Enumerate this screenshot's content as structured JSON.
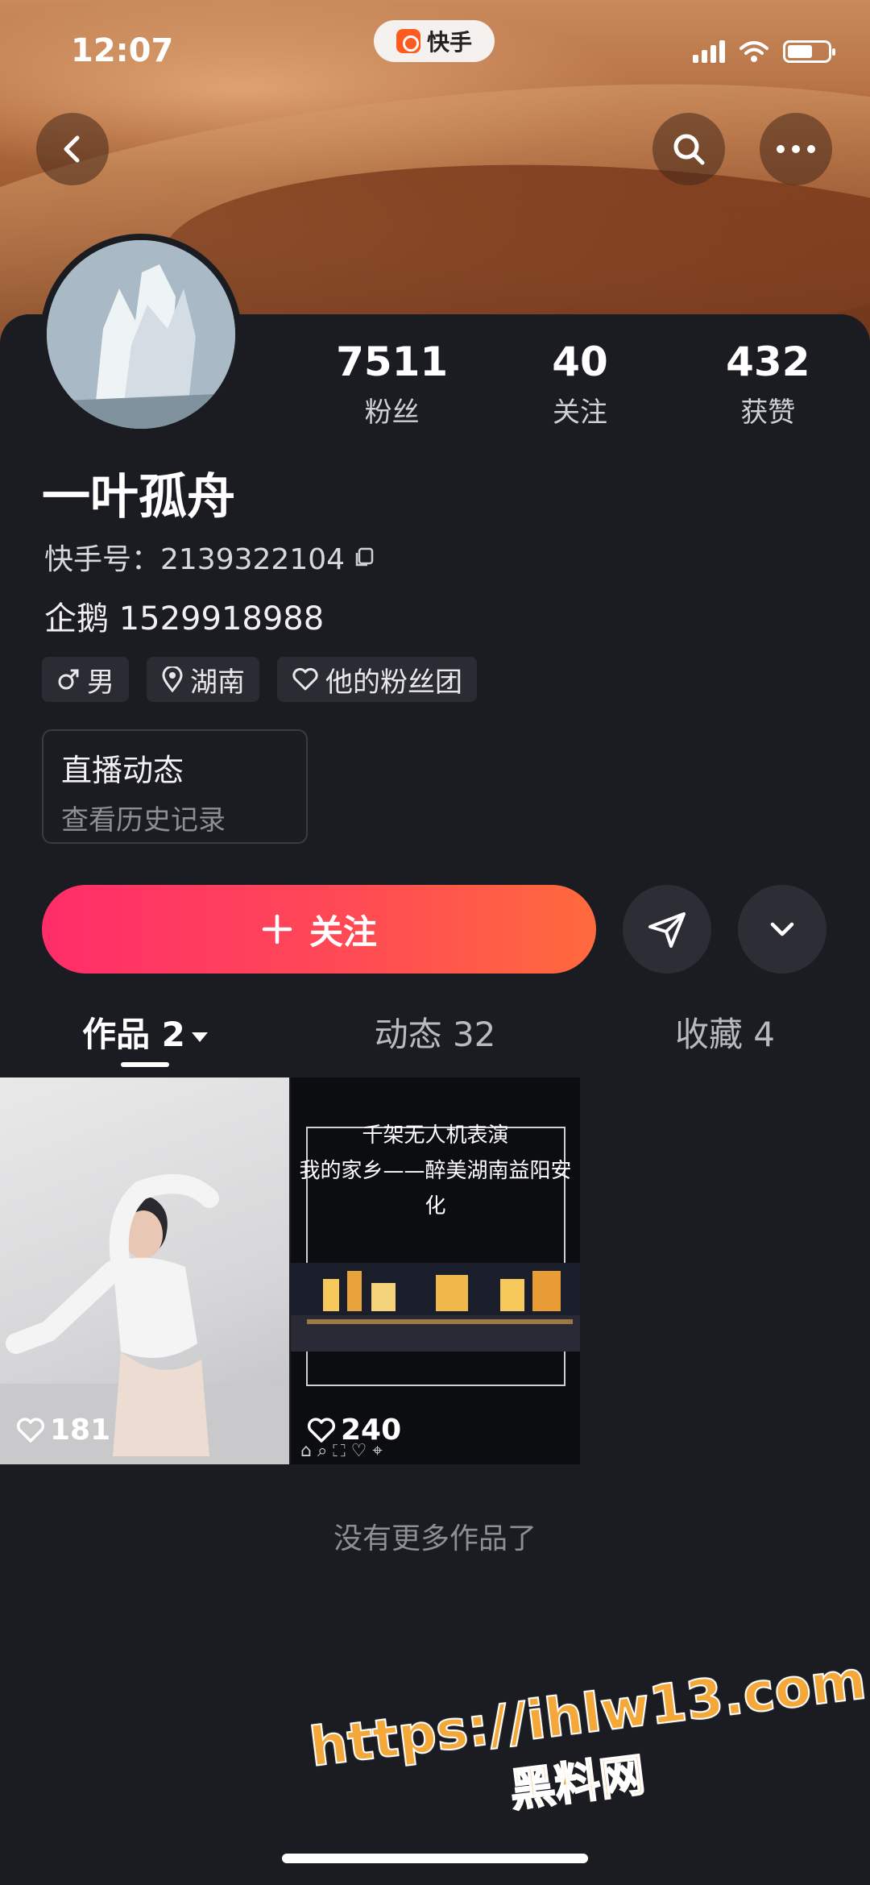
{
  "status_bar": {
    "time": "12:07",
    "app_name": "快手"
  },
  "profile": {
    "name": "一叶孤舟",
    "kuaishou_id": "快手号：2139322104",
    "bio": "企鹅 1529918988",
    "stats": [
      {
        "value": "7511",
        "label": "粉丝"
      },
      {
        "value": "40",
        "label": "关注"
      },
      {
        "value": "432",
        "label": "获赞"
      }
    ],
    "tags": [
      {
        "icon": "male-icon",
        "label": "男"
      },
      {
        "icon": "location-pin-icon",
        "label": "湖南"
      },
      {
        "icon": "heart-outline-icon",
        "label": "他的粉丝团"
      }
    ],
    "live_card": {
      "title": "直播动态",
      "subtitle": "查看历史记录"
    },
    "follow_label": "关注"
  },
  "tabs": [
    {
      "label": "作品 2",
      "active": true
    },
    {
      "label": "动态 32",
      "active": false
    },
    {
      "label": "收藏 4",
      "active": false
    }
  ],
  "works": [
    {
      "likes": "181",
      "caption_lines": []
    },
    {
      "likes": "240",
      "caption_lines": [
        "千架无人机表演",
        "我的家乡——醉美湖南益阳安化"
      ]
    }
  ],
  "end_text": "没有更多作品了",
  "watermark": {
    "url": "https://ihlw13.com",
    "name": "黑料网"
  }
}
